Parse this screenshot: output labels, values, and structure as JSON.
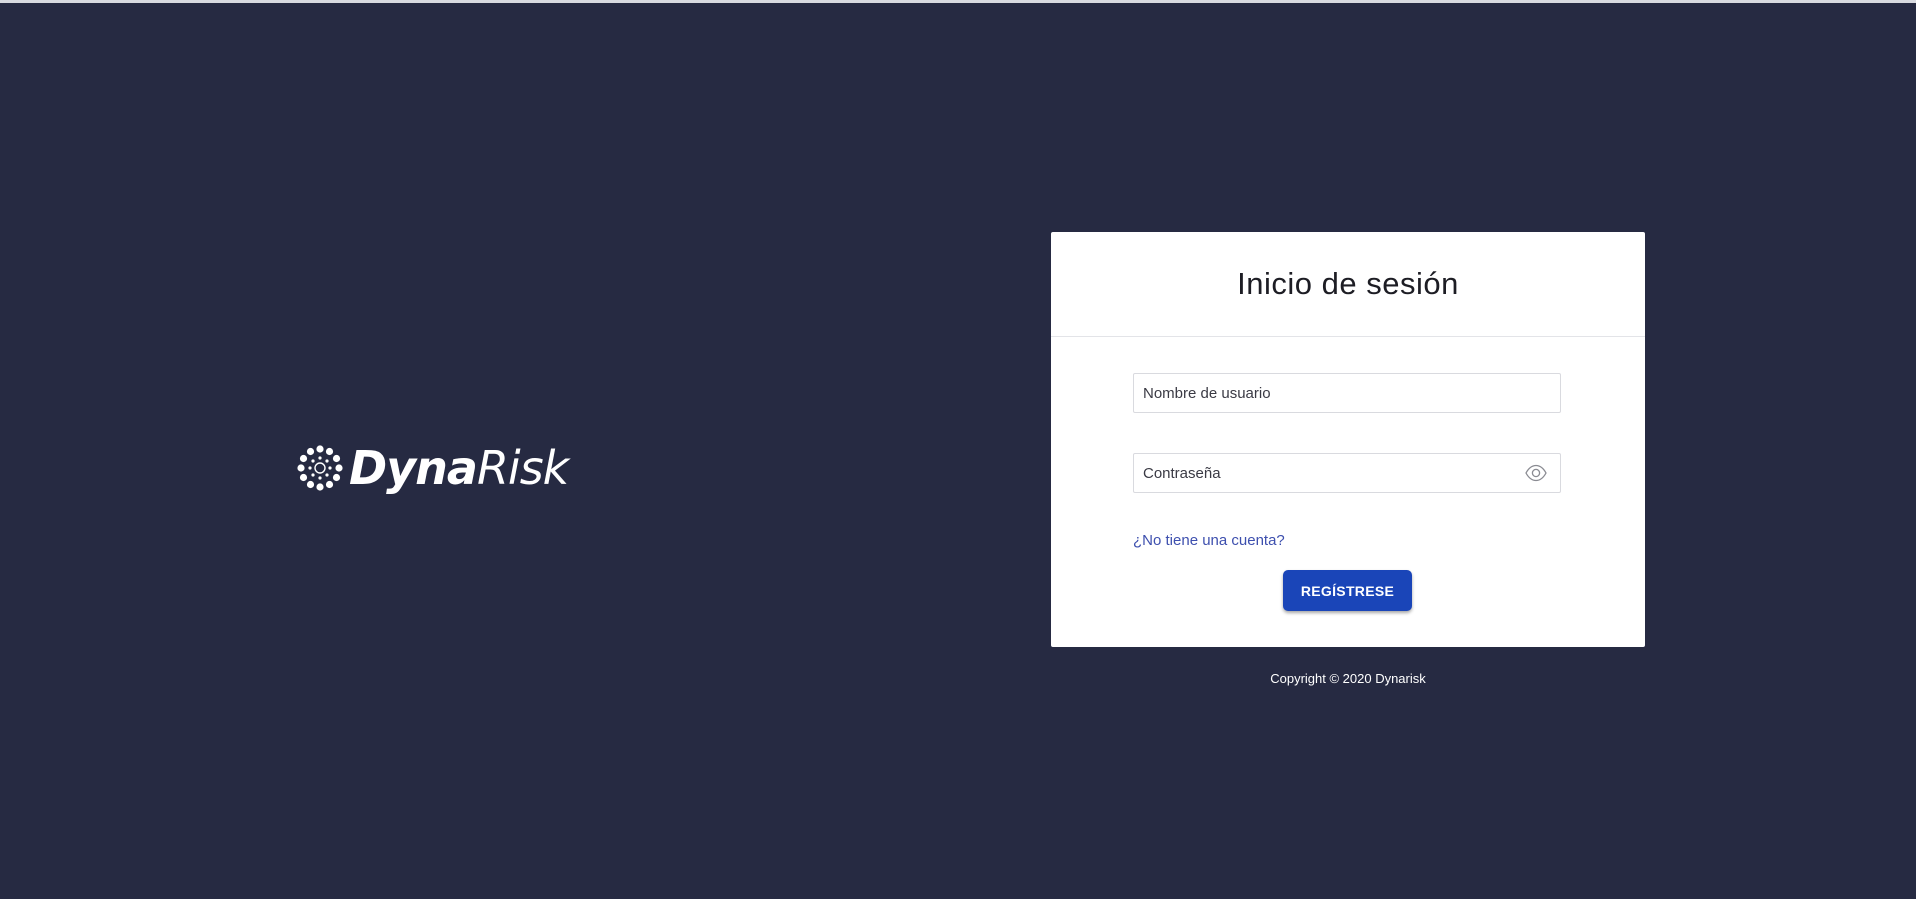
{
  "brand": {
    "name_bold": "Dyna",
    "name_light": "Risk",
    "logo_icon": "dotted-circle-logo-icon"
  },
  "login": {
    "title": "Inicio de sesión",
    "username_placeholder": "Nombre de usuario",
    "password_placeholder": "Contraseña",
    "password_toggle_icon": "eye-icon",
    "signup_prompt": "¿No tiene una cuenta?",
    "register_label": "REGÍSTRESE"
  },
  "footer": {
    "copyright": "Copyright © 2020 Dynarisk"
  },
  "colors": {
    "background": "#262a42",
    "card": "#ffffff",
    "primary": "#1a45b8",
    "link": "#3d4fae"
  }
}
